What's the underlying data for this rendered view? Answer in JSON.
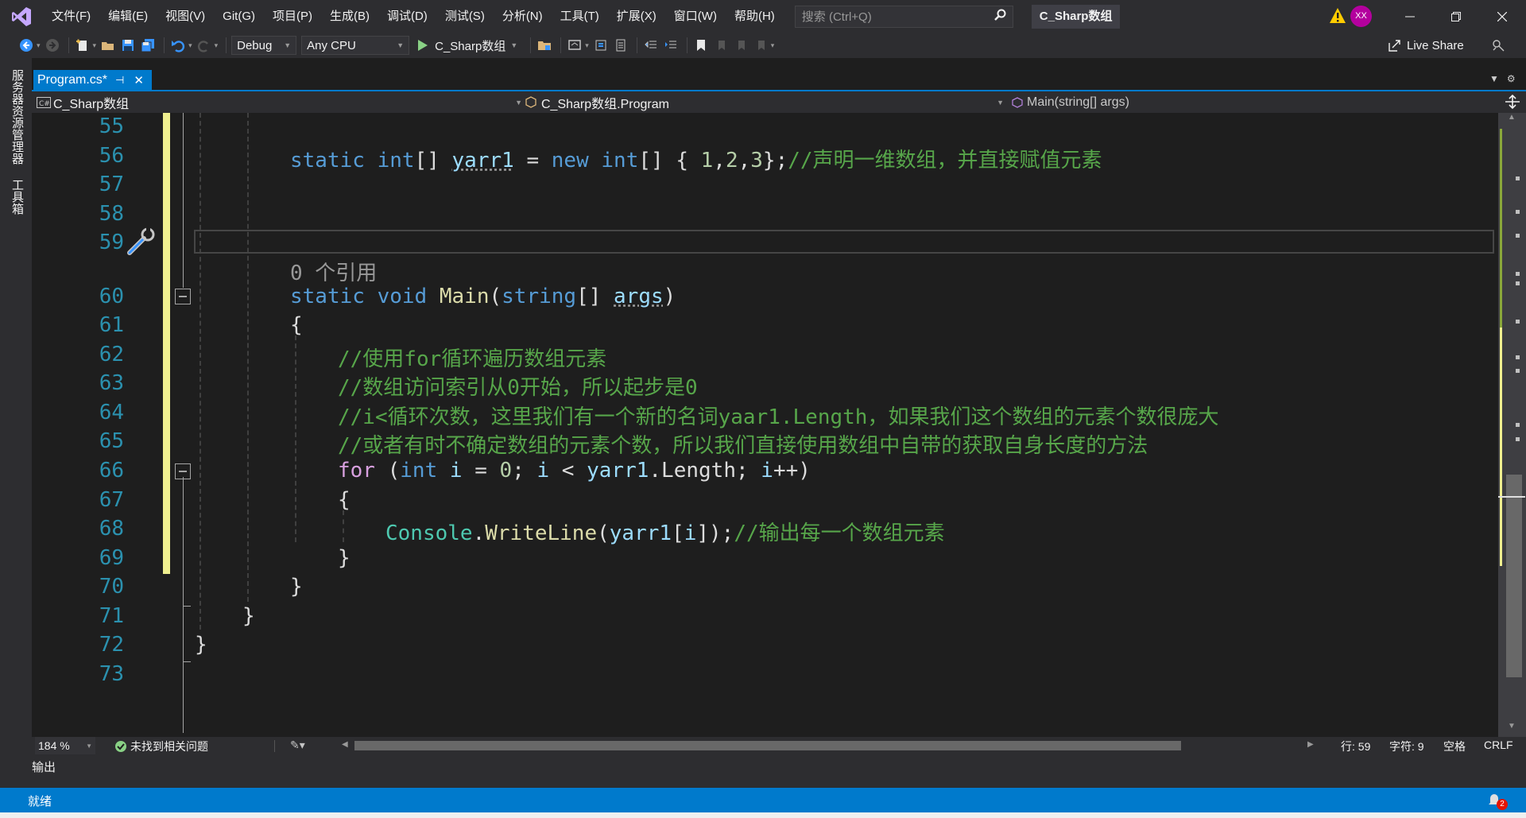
{
  "menu": [
    "文件(F)",
    "编辑(E)",
    "视图(V)",
    "Git(G)",
    "项目(P)",
    "生成(B)",
    "调试(D)",
    "测试(S)",
    "分析(N)",
    "工具(T)",
    "扩展(X)",
    "窗口(W)",
    "帮助(H)"
  ],
  "search": {
    "placeholder": "搜索 (Ctrl+Q)"
  },
  "solution_title": "C_Sharp数组",
  "user": {
    "initials": "XX"
  },
  "toolbar": {
    "config": "Debug",
    "platform": "Any CPU",
    "run_label": "C_Sharp数组",
    "live_share": "Live Share"
  },
  "left_dock": {
    "tab1": "服务器资源管理器",
    "tab2": "工具箱"
  },
  "tab": {
    "label": "Program.cs*",
    "pin": "⊣",
    "close": "✕"
  },
  "navbar": {
    "project": "C_Sharp数组",
    "type": "C_Sharp数组.Program",
    "member": "Main(string[] args)"
  },
  "editor": {
    "line_numbers": [
      "55",
      "56",
      "57",
      "58",
      "59",
      "60",
      "61",
      "62",
      "63",
      "64",
      "65",
      "66",
      "67",
      "68",
      "69",
      "70",
      "71",
      "72",
      "73"
    ],
    "codelens": "0 个引用",
    "lines": {
      "l56": {
        "static": "static",
        "int": "int",
        "rest1": "[] ",
        "name": "yarr1",
        "eq": " = ",
        "new": "new",
        "int2": "int",
        "rest2": "[] { ",
        "n1": "1",
        "c1": ",",
        "n2": "2",
        "c2": ",",
        "n3": "3",
        "rest3": "};",
        "comment": "//声明一维数组，并直接赋值元素"
      },
      "l60": {
        "static": "static",
        "void": "void",
        "main": "Main",
        "p1": "(",
        "string": "string",
        "p2": "[] ",
        "args": "args",
        "p3": ")"
      },
      "l61": "{",
      "l62": "//使用for循环遍历数组元素",
      "l63": "//数组访问索引从0开始，所以起步是0",
      "l64": "//i<循环次数，这里我们有一个新的名词yaar1.Length，如果我们这个数组的元素个数很庞大",
      "l65": "//或者有时不确定数组的元素个数，所以我们直接使用数组中自带的获取自身长度的方法",
      "l66": {
        "for": "for",
        "p1": " (",
        "int": "int",
        "a": " ",
        "i": "i",
        "b": " = ",
        "zero": "0",
        "c": "; ",
        "i2": "i",
        "d": " < ",
        "yarr": "yarr1",
        "e": ".Length; ",
        "i3": "i",
        "f": "++)"
      },
      "l67": "{",
      "l68": {
        "console": "Console",
        "dot": ".",
        "wl": "WriteLine",
        "p1": "(",
        "yarr": "yarr1",
        "b1": "[",
        "i": "i",
        "b2": "]);",
        "comment": "//输出每一个数组元素"
      },
      "l69": "}",
      "l70": "}",
      "l71": "}",
      "l72": "}"
    }
  },
  "editor_status": {
    "zoom": "184 %",
    "issues": "未找到相关问题",
    "line": "行: 59",
    "char": "字符: 9",
    "spacing": "空格",
    "eol": "CRLF"
  },
  "output_tab": "输出",
  "statusbar": {
    "ready": "就绪",
    "notifications": "2"
  },
  "colors": {
    "accent": "#007acc",
    "background": "#1e1e1e",
    "chrome": "#2d2d30",
    "change_bar": "#efef8f"
  }
}
